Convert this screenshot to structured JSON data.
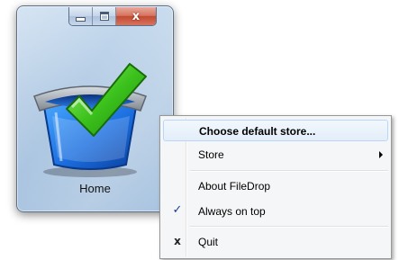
{
  "window": {
    "title_buttons": [
      "minimize",
      "maximize",
      "close"
    ],
    "close_glyph": "x",
    "app_icon": "checked-basket-icon",
    "app_label": "Home"
  },
  "menu": {
    "items": [
      {
        "label": "Choose default store...",
        "default": true,
        "highlighted": true
      },
      {
        "label": "Store",
        "submenu": true
      },
      {
        "label": "About FileDrop"
      },
      {
        "label": "Always on top",
        "checked": true,
        "check_glyph": "✓"
      },
      {
        "label": "Quit",
        "mark_glyph": "x"
      }
    ]
  },
  "colors": {
    "window_glass": "#b3cbe4",
    "close_button": "#c14a32",
    "menu_highlight_border": "#b8d6fb",
    "check_mark": "#1b3f8f"
  }
}
